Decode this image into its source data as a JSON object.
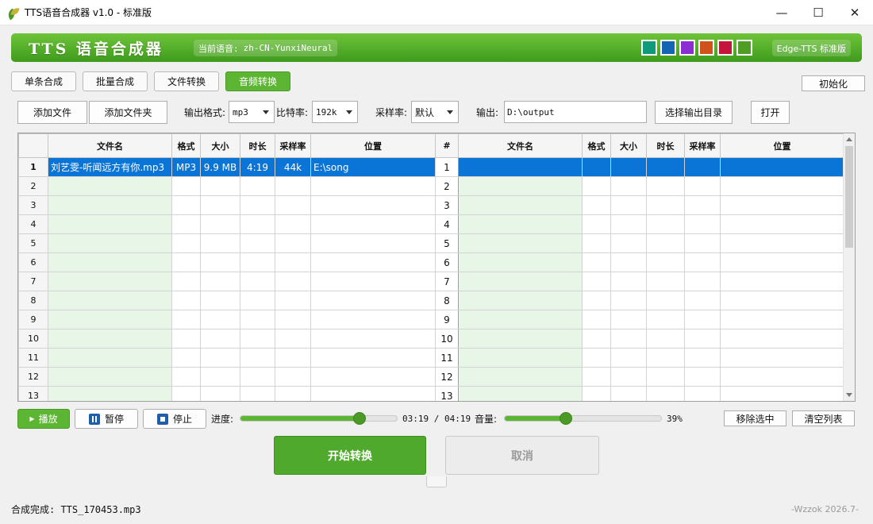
{
  "window": {
    "title": "TTS语音合成器 v1.0 - 标准版",
    "controls": [
      "—",
      "☐",
      "✕"
    ]
  },
  "header": {
    "app_name": "TTS 语音合成器",
    "voice_label": "当前语音:",
    "voice_value": "zh-CN-YunxiNeural",
    "theme_colors": [
      "#0f9a7c",
      "#1565b5",
      "#8a2fd2",
      "#d0531a",
      "#c4143c",
      "#4d9e23"
    ],
    "edition": "Edge-TTS 标准版"
  },
  "tabs": [
    {
      "label": "单条合成",
      "active": false
    },
    {
      "label": "批量合成",
      "active": false
    },
    {
      "label": "文件转换",
      "active": false
    },
    {
      "label": "音频转换",
      "active": true
    }
  ],
  "init_label": "初始化",
  "toolbar": {
    "add_file": "添加文件",
    "add_folder": "添加文件夹",
    "format_label": "输出格式:",
    "format_value": "mp3",
    "bitrate_label": "比特率:",
    "bitrate_value": "192k",
    "samplerate_label": "采样率:",
    "samplerate_value": "默认",
    "output_label": "输出:",
    "output_value": "D:\\output",
    "choose_dir": "选择输出目录",
    "open": "打开"
  },
  "grid": {
    "left_headers": [
      "文件名",
      "格式",
      "大小",
      "时长",
      "采样率",
      "位置"
    ],
    "mid_header": "#",
    "right_headers": [
      "文件名",
      "格式",
      "大小",
      "时长",
      "采样率",
      "位置"
    ],
    "row_numbers": [
      "1",
      "2",
      "3",
      "4",
      "5",
      "6",
      "7",
      "8",
      "9",
      "10",
      "11",
      "12",
      "13"
    ],
    "rows": [
      {
        "file": "刘艺雯-听闻远方有你.mp3",
        "format": "MP3",
        "size": "9.9 MB",
        "duration": "4:19",
        "samplerate": "44k",
        "location": "E:\\song"
      }
    ]
  },
  "player": {
    "play": "播放",
    "pause": "暂停",
    "stop": "停止",
    "progress_label": "进度:",
    "progress": 0.76,
    "time": "03:19 / 04:19",
    "volume_label": "音量:",
    "volume": 0.39,
    "volume_text": "39%",
    "remove_selected": "移除选中",
    "clear_list": "清空列表"
  },
  "actions": {
    "start": "开始转换",
    "cancel": "取消"
  },
  "status": {
    "message": "合成完成: TTS_170453.mp3",
    "credit": "-Wzzok 2026.7-"
  }
}
